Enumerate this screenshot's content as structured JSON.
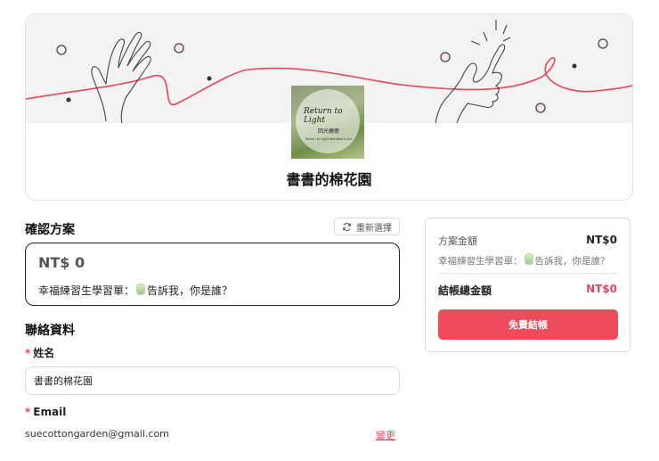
{
  "banner": {
    "title": "書書的棉花園",
    "avatar_text": {
      "line1": "Return to Light",
      "line2": "回光療癒",
      "line3": "Return to Light Mandala & Art"
    }
  },
  "plan": {
    "section_title": "確認方案",
    "reselect_label": "重新選擇",
    "price": "NT$ 0",
    "name_prefix": "幸福練習生學習單：",
    "name_suffix": "告訴我，你是誰？"
  },
  "contact": {
    "section_title": "聯絡資料",
    "name_label": "姓名",
    "name_value": "書書的棉花園",
    "email_label": "Email",
    "email_value": "suecottongarden@gmail.com",
    "change_label": "變更",
    "required_mark": "*"
  },
  "summary": {
    "plan_amount_label": "方案金額",
    "plan_amount": "NT$0",
    "plan_prefix": "幸福練習生學習單：",
    "plan_suffix": "告訴我，你是誰？",
    "total_label": "結帳總金額",
    "total_amount": "NT$0",
    "checkout_label": "免費結帳"
  },
  "colors": {
    "accent": "#f04a5d",
    "banner_bg": "#f3f3f3"
  }
}
